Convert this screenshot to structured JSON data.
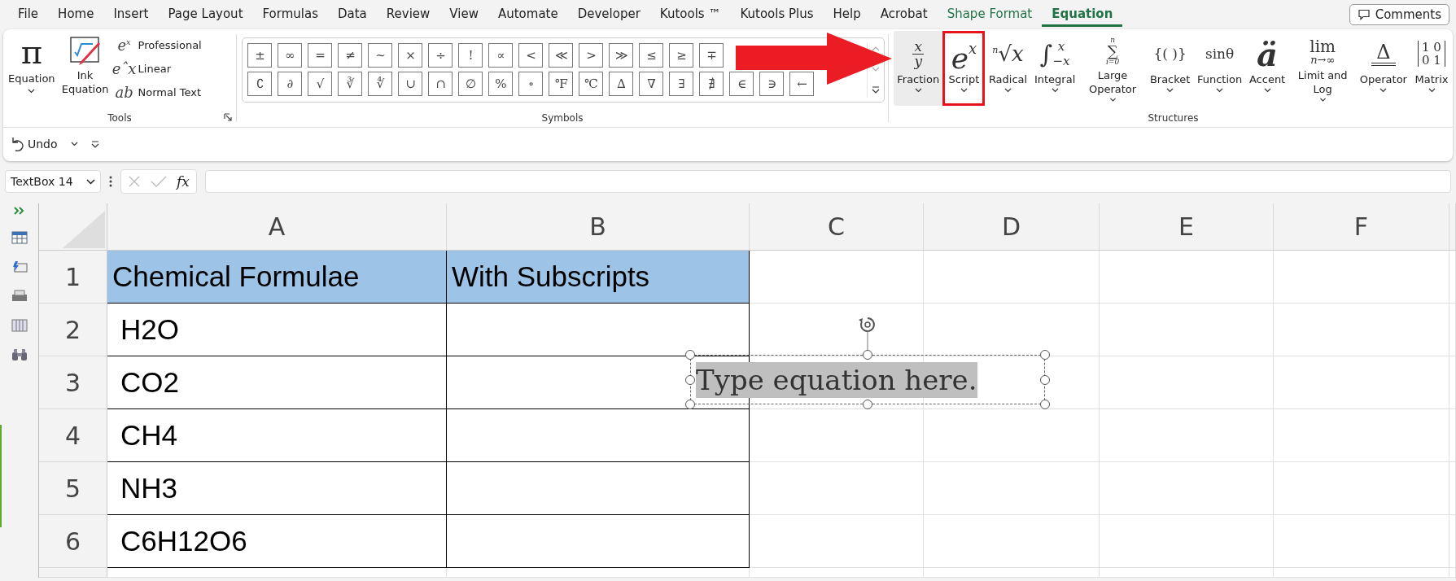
{
  "tabs": [
    {
      "label": "File",
      "selected": false,
      "contextual": false
    },
    {
      "label": "Home",
      "selected": false,
      "contextual": false
    },
    {
      "label": "Insert",
      "selected": false,
      "contextual": false
    },
    {
      "label": "Page Layout",
      "selected": false,
      "contextual": false
    },
    {
      "label": "Formulas",
      "selected": false,
      "contextual": false
    },
    {
      "label": "Data",
      "selected": false,
      "contextual": false
    },
    {
      "label": "Review",
      "selected": false,
      "contextual": false
    },
    {
      "label": "View",
      "selected": false,
      "contextual": false
    },
    {
      "label": "Automate",
      "selected": false,
      "contextual": false
    },
    {
      "label": "Developer",
      "selected": false,
      "contextual": false
    },
    {
      "label": "Kutools ™",
      "selected": false,
      "contextual": false
    },
    {
      "label": "Kutools Plus",
      "selected": false,
      "contextual": false
    },
    {
      "label": "Help",
      "selected": false,
      "contextual": false
    },
    {
      "label": "Acrobat",
      "selected": false,
      "contextual": false
    },
    {
      "label": "Shape Format",
      "selected": false,
      "contextual": true
    },
    {
      "label": "Equation",
      "selected": true,
      "contextual": true
    }
  ],
  "comments_button": {
    "label": "Comments"
  },
  "tools_group": {
    "label": "Tools",
    "equation": {
      "label": "Equation",
      "glyph": "π"
    },
    "ink_equation": {
      "label": "Ink Equation"
    },
    "options": [
      {
        "label": "Professional",
        "glyph": "e$^{x}$"
      },
      {
        "label": "Linear",
        "glyph": "eˆx"
      },
      {
        "label": "Normal Text",
        "glyph": "ab"
      }
    ]
  },
  "symbols_group": {
    "label": "Symbols",
    "rows": [
      [
        "±",
        "∞",
        "=",
        "≠",
        "~",
        "×",
        "÷",
        "!",
        "∝",
        "<",
        "≪",
        ">",
        "≫",
        "≤",
        "≥",
        "∓"
      ],
      [
        "∁",
        "∂",
        "√",
        "∛",
        "∜",
        "∪",
        "∩",
        "∅",
        "%",
        "∘",
        "℉",
        "℃",
        "∆",
        "∇",
        "∃",
        "∄",
        "∈",
        "∋",
        "←"
      ]
    ]
  },
  "structures_group": {
    "label": "Structures",
    "items": [
      {
        "kind": "fraction",
        "label": "Fraction",
        "top": "x",
        "bottom": "y",
        "hovered": true,
        "highlighted": false
      },
      {
        "kind": "script",
        "label": "Script",
        "glyph": "e$^{x}$",
        "hovered": false,
        "highlighted": true
      },
      {
        "kind": "radical",
        "label": "Radical",
        "glyph": "$^{n}$√x",
        "hovered": false,
        "highlighted": false
      },
      {
        "kind": "integral",
        "label": "Integral",
        "main": "∫",
        "top": "x",
        "bottom": "−x",
        "hovered": false,
        "highlighted": false
      },
      {
        "kind": "large_operator",
        "label": "Large Operator",
        "main": "∑",
        "top": "n",
        "bottom": "i=0",
        "hovered": false,
        "highlighted": false
      },
      {
        "kind": "plain",
        "label": "Bracket",
        "glyph": "{( )}",
        "hovered": false,
        "highlighted": false
      },
      {
        "kind": "plain",
        "label": "Function",
        "glyph": "sinθ",
        "hovered": false,
        "highlighted": false
      },
      {
        "kind": "accent",
        "label": "Accent",
        "glyph": "ä",
        "hovered": false,
        "highlighted": false
      },
      {
        "kind": "limit",
        "label": "Limit and Log",
        "main": "lim",
        "bottom": "n→∞",
        "hovered": false,
        "highlighted": false
      },
      {
        "kind": "operator",
        "label": "Operator",
        "main": "Δ",
        "hovered": false,
        "highlighted": false
      },
      {
        "kind": "matrix",
        "label": "Matrix",
        "rows": [
          "1 0",
          "0 1"
        ],
        "hovered": false,
        "highlighted": false
      }
    ]
  },
  "quick_access": {
    "undo": {
      "label": "Undo"
    }
  },
  "formula_bar": {
    "name_box": "TextBox 14",
    "function_label": "fx"
  },
  "sheet": {
    "columns": [
      "A",
      "B",
      "C",
      "D",
      "E",
      "F"
    ],
    "rows": [
      {
        "number": "1",
        "kind": "header",
        "cells": [
          "Chemical Formulae",
          "With Subscripts"
        ]
      },
      {
        "number": "2",
        "kind": "data",
        "cells": [
          "H2O"
        ]
      },
      {
        "number": "3",
        "kind": "data",
        "cells": [
          "CO2"
        ]
      },
      {
        "number": "4",
        "kind": "data",
        "cells": [
          "CH4"
        ]
      },
      {
        "number": "5",
        "kind": "data",
        "cells": [
          "NH3"
        ]
      },
      {
        "number": "6",
        "kind": "data",
        "cells": [
          "C6H12O6"
        ]
      }
    ]
  },
  "equation_box": {
    "placeholder": "Type equation here.",
    "selected": true
  }
}
